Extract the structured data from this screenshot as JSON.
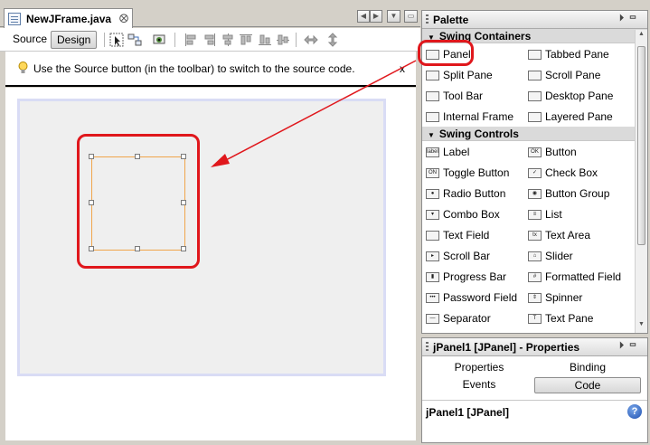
{
  "editor": {
    "tab": {
      "title": "NewJFrame.java",
      "close": "⨂"
    },
    "tab_controls": [
      "◀",
      "▶",
      "▼",
      "▭"
    ],
    "toolbar": {
      "source_label": "Source",
      "design_label": "Design"
    },
    "info": {
      "message": "Use the Source button (in the toolbar) to switch to the source code.",
      "close": "x"
    }
  },
  "palette": {
    "title": "Palette",
    "window_buttons": "⏵▭",
    "categories": [
      {
        "name": "Swing Containers",
        "items": [
          {
            "label": "Panel",
            "icon": "panel-icon"
          },
          {
            "label": "Tabbed Pane",
            "icon": "tabbed-pane-icon"
          },
          {
            "label": "Split Pane",
            "icon": "split-pane-icon"
          },
          {
            "label": "Scroll Pane",
            "icon": "scroll-pane-icon"
          },
          {
            "label": "Tool Bar",
            "icon": "tool-bar-icon"
          },
          {
            "label": "Desktop Pane",
            "icon": "desktop-pane-icon"
          },
          {
            "label": "Internal Frame",
            "icon": "internal-frame-icon"
          },
          {
            "label": "Layered Pane",
            "icon": "layered-pane-icon"
          }
        ]
      },
      {
        "name": "Swing Controls",
        "items": [
          {
            "label": "Label",
            "icon": "label-icon",
            "glyph": "label"
          },
          {
            "label": "Button",
            "icon": "button-icon",
            "glyph": "OK"
          },
          {
            "label": "Toggle Button",
            "icon": "toggle-button-icon",
            "glyph": "ON"
          },
          {
            "label": "Check Box",
            "icon": "check-box-icon",
            "glyph": "✓"
          },
          {
            "label": "Radio Button",
            "icon": "radio-button-icon",
            "glyph": "●"
          },
          {
            "label": "Button Group",
            "icon": "button-group-icon",
            "glyph": "◉"
          },
          {
            "label": "Combo Box",
            "icon": "combo-box-icon",
            "glyph": "▾"
          },
          {
            "label": "List",
            "icon": "list-icon",
            "glyph": "≡"
          },
          {
            "label": "Text Field",
            "icon": "text-field-icon",
            "glyph": ""
          },
          {
            "label": "Text Area",
            "icon": "text-area-icon",
            "glyph": "tx"
          },
          {
            "label": "Scroll Bar",
            "icon": "scroll-bar-icon",
            "glyph": "▸"
          },
          {
            "label": "Slider",
            "icon": "slider-icon",
            "glyph": "⌂"
          },
          {
            "label": "Progress Bar",
            "icon": "progress-bar-icon",
            "glyph": "▮"
          },
          {
            "label": "Formatted Field",
            "icon": "formatted-field-icon",
            "glyph": "#"
          },
          {
            "label": "Password Field",
            "icon": "password-field-icon",
            "glyph": "•••"
          },
          {
            "label": "Spinner",
            "icon": "spinner-icon",
            "glyph": "⇕"
          },
          {
            "label": "Separator",
            "icon": "separator-icon",
            "glyph": "—"
          },
          {
            "label": "Text Pane",
            "icon": "text-pane-icon",
            "glyph": "T"
          }
        ]
      }
    ]
  },
  "properties": {
    "title": "jPanel1 [JPanel] - Properties",
    "tabs": [
      "Properties",
      "Binding",
      "Events",
      "Code"
    ],
    "selected_tab": "Code",
    "footer": "jPanel1 [JPanel]",
    "help": "?"
  },
  "colors": {
    "annotation_red": "#e0171c",
    "selection_orange": "#f0a54b"
  }
}
